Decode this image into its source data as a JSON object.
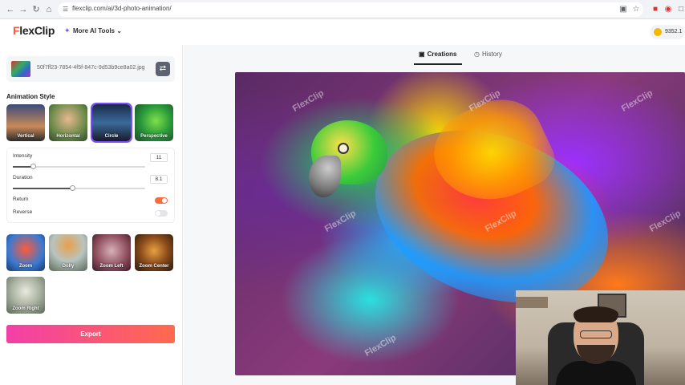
{
  "browser": {
    "url": "flexclip.com/ai/3d-photo-animation/"
  },
  "app": {
    "logo_prefix": "F",
    "logo_rest": "lexClip",
    "ai_tools_label": "More AI Tools",
    "credits": "9352.1"
  },
  "file": {
    "name": "50f7ff23-7854-4f5f-847c-9d53b9ce8a02.jpg"
  },
  "animation_style": {
    "title": "Animation Style",
    "top_styles": [
      {
        "label": "Vertical"
      },
      {
        "label": "Horizontal"
      },
      {
        "label": "Circle"
      },
      {
        "label": "Perspective"
      }
    ],
    "selected": "Circle",
    "bottom_styles": [
      {
        "label": "Zoom"
      },
      {
        "label": "Dolly"
      },
      {
        "label": "Zoom Left"
      },
      {
        "label": "Zoom Center"
      },
      {
        "label": "Zoom Right"
      }
    ]
  },
  "settings": {
    "intensity_label": "Intensity",
    "intensity_value": "11",
    "intensity_fraction": 0.15,
    "duration_label": "Duration",
    "duration_value": "8.1",
    "duration_fraction": 0.45,
    "return_label": "Return",
    "return_on": true,
    "reverse_label": "Reverse",
    "reverse_on": false
  },
  "export_label": "Export",
  "tabs": [
    {
      "label": "Creations",
      "active": true
    },
    {
      "label": "History",
      "active": false
    }
  ],
  "preview": {
    "watermark": "FlexClip"
  },
  "colors": {
    "accent": "#7b4dff",
    "brand_orange": "#ff5a3c",
    "toggle_on": "#ff6a3d"
  }
}
